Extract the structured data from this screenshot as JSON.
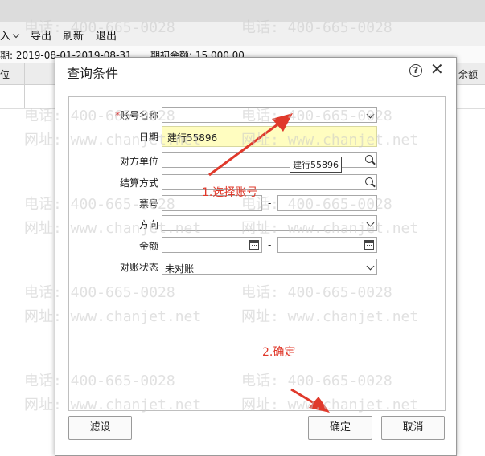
{
  "app": {
    "toolbar": {
      "import_label": "入",
      "export_label": "导出",
      "refresh_label": "刷新",
      "exit_label": "退出"
    },
    "infobar": {
      "period_text": "期: 2019-08-01-2019-08-31",
      "opening_balance_text": "期初余额: 15,000.00"
    },
    "grid": {
      "col_left": "位",
      "col_right": "余额"
    }
  },
  "dialog": {
    "title": "查询条件",
    "help_glyph": "?",
    "close_glyph": "✕",
    "form": {
      "account_name": {
        "required_mark": "*",
        "label": "账号名称",
        "value": ""
      },
      "date": {
        "label": "日期"
      },
      "counterparty": {
        "label": "对方单位",
        "value": ""
      },
      "settlement_method": {
        "label": "结算方式",
        "value": ""
      },
      "ticket_no": {
        "label": "票号",
        "from": "",
        "to": "",
        "separator": "-"
      },
      "direction": {
        "label": "方向",
        "value": ""
      },
      "amount": {
        "label": "金额",
        "from": "",
        "to": "",
        "separator": "-"
      },
      "reconcile_status": {
        "label": "对账状态",
        "value": "未对账"
      }
    },
    "account_dropdown_option": "建行55896",
    "tooltip": "建行55896",
    "buttons": {
      "filter_settings": "滤设",
      "ok": "确定",
      "cancel": "取消"
    }
  },
  "annotations": {
    "step1": "1.选择账号",
    "step2": "2.确定",
    "color": "#e0392b"
  },
  "watermark": {
    "phone": "电话: 400-665-0028",
    "site": "网址: www.chanjet.net"
  }
}
